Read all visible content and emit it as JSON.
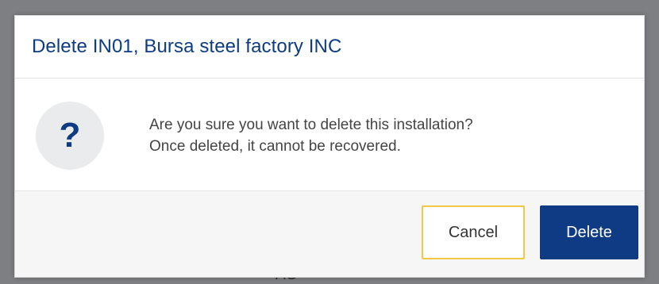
{
  "backdrop": {
    "partial_text": "AG"
  },
  "dialog": {
    "title": "Delete IN01, Bursa steel factory INC",
    "icon": "question-mark-icon",
    "icon_glyph": "?",
    "message_line1": "Are you sure you want to delete this installation?",
    "message_line2": "Once deleted, it cannot be recovered.",
    "buttons": {
      "cancel_label": "Cancel",
      "delete_label": "Delete"
    }
  },
  "colors": {
    "title": "#0d3c83",
    "primary_button": "#0f3a84",
    "cancel_focus_border": "#f2c744",
    "icon_bg": "#eaebed",
    "footer_bg": "#f6f6f7",
    "overlay": "#7d7f82"
  }
}
